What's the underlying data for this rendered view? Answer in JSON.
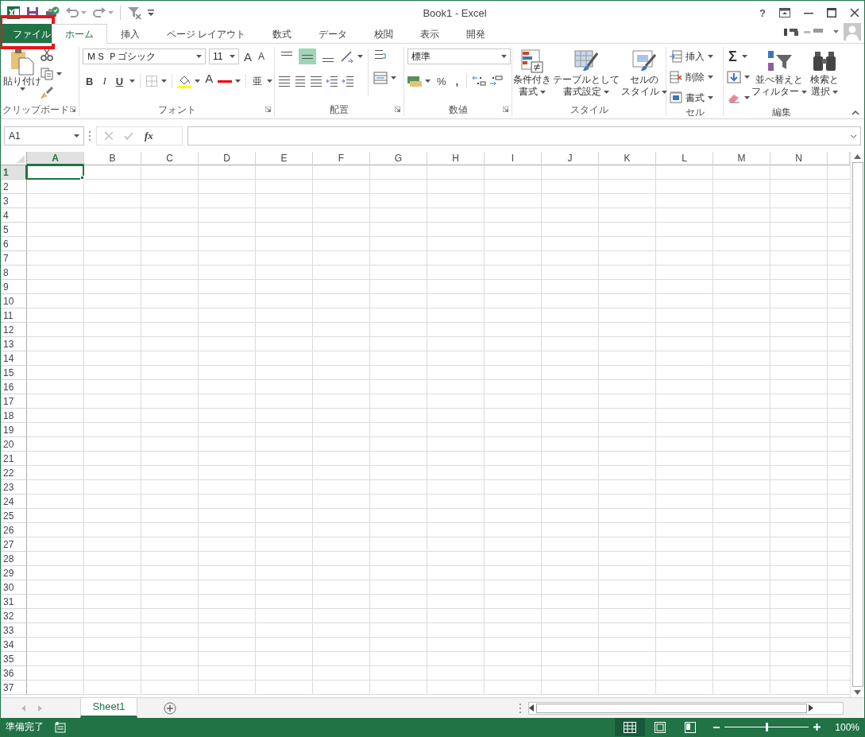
{
  "window": {
    "title": "Book1 - Excel",
    "help": "?"
  },
  "tabs": [
    {
      "label": "ファイル",
      "kind": "file",
      "selected": false,
      "highlighted": true
    },
    {
      "label": "ホーム",
      "kind": "tab",
      "selected": true,
      "highlighted": false
    },
    {
      "label": "挿入",
      "kind": "tab",
      "selected": false,
      "highlighted": false
    },
    {
      "label": "ページ レイアウト",
      "kind": "tab",
      "selected": false,
      "highlighted": false
    },
    {
      "label": "数式",
      "kind": "tab",
      "selected": false,
      "highlighted": false
    },
    {
      "label": "データ",
      "kind": "tab",
      "selected": false,
      "highlighted": false
    },
    {
      "label": "校閲",
      "kind": "tab",
      "selected": false,
      "highlighted": false
    },
    {
      "label": "表示",
      "kind": "tab",
      "selected": false,
      "highlighted": false
    },
    {
      "label": "開発",
      "kind": "tab",
      "selected": false,
      "highlighted": false
    }
  ],
  "ribbon": {
    "groups": [
      {
        "kind": "clipboard",
        "label": "クリップボード",
        "paste": "貼り付け"
      },
      {
        "kind": "font",
        "label": "フォント",
        "font_name": "ＭＳ Ｐゴシック",
        "font_size": "11",
        "grow": "A",
        "shrink": "A",
        "bold": "B",
        "italic": "I",
        "underline": "U",
        "font_color": "A",
        "phonetic": "亜"
      },
      {
        "kind": "alignment",
        "label": "配置",
        "vertical": [
          {
            "selected": false
          },
          {
            "selected": true
          },
          {
            "selected": false
          }
        ]
      },
      {
        "kind": "number",
        "label": "数値",
        "format": "標準",
        "percent": "%",
        "comma": ","
      },
      {
        "kind": "styles",
        "label": "スタイル",
        "buttons": [
          {
            "lines": [
              "条件付き",
              "書式"
            ]
          },
          {
            "lines": [
              "テーブルとして",
              "書式設定"
            ]
          },
          {
            "lines": [
              "セルの",
              "スタイル"
            ]
          }
        ]
      },
      {
        "kind": "cells",
        "label": "セル",
        "buttons": [
          "挿入",
          "削除",
          "書式"
        ]
      },
      {
        "kind": "editing",
        "label": "編集",
        "sum": "Σ",
        "buttons": [
          {
            "lines": [
              "並べ替えと",
              "フィルター"
            ]
          },
          {
            "lines": [
              "検索と",
              "選択"
            ]
          }
        ]
      }
    ]
  },
  "name_box": {
    "value": "A1"
  },
  "formula_bar": {
    "function_label": "fx"
  },
  "columns": [
    {
      "label": "A",
      "selected": true
    },
    {
      "label": "B",
      "selected": false
    },
    {
      "label": "C",
      "selected": false
    },
    {
      "label": "D",
      "selected": false
    },
    {
      "label": "E",
      "selected": false
    },
    {
      "label": "F",
      "selected": false
    },
    {
      "label": "G",
      "selected": false
    },
    {
      "label": "H",
      "selected": false
    },
    {
      "label": "I",
      "selected": false
    },
    {
      "label": "J",
      "selected": false
    },
    {
      "label": "K",
      "selected": false
    },
    {
      "label": "L",
      "selected": false
    },
    {
      "label": "M",
      "selected": false
    },
    {
      "label": "N",
      "selected": false
    }
  ],
  "rows": [
    {
      "label": "1",
      "selected": true
    },
    {
      "label": "2",
      "selected": false
    },
    {
      "label": "3",
      "selected": false
    },
    {
      "label": "4",
      "selected": false
    },
    {
      "label": "5",
      "selected": false
    },
    {
      "label": "6",
      "selected": false
    },
    {
      "label": "7",
      "selected": false
    },
    {
      "label": "8",
      "selected": false
    },
    {
      "label": "9",
      "selected": false
    },
    {
      "label": "10",
      "selected": false
    },
    {
      "label": "11",
      "selected": false
    },
    {
      "label": "12",
      "selected": false
    },
    {
      "label": "13",
      "selected": false
    },
    {
      "label": "14",
      "selected": false
    },
    {
      "label": "15",
      "selected": false
    },
    {
      "label": "16",
      "selected": false
    },
    {
      "label": "17",
      "selected": false
    },
    {
      "label": "18",
      "selected": false
    },
    {
      "label": "19",
      "selected": false
    },
    {
      "label": "20",
      "selected": false
    },
    {
      "label": "21",
      "selected": false
    },
    {
      "label": "22",
      "selected": false
    },
    {
      "label": "23",
      "selected": false
    },
    {
      "label": "24",
      "selected": false
    },
    {
      "label": "25",
      "selected": false
    },
    {
      "label": "26",
      "selected": false
    },
    {
      "label": "27",
      "selected": false
    },
    {
      "label": "28",
      "selected": false
    },
    {
      "label": "29",
      "selected": false
    },
    {
      "label": "30",
      "selected": false
    },
    {
      "label": "31",
      "selected": false
    },
    {
      "label": "32",
      "selected": false
    },
    {
      "label": "33",
      "selected": false
    },
    {
      "label": "34",
      "selected": false
    },
    {
      "label": "35",
      "selected": false
    },
    {
      "label": "36",
      "selected": false
    },
    {
      "label": "37",
      "selected": false
    }
  ],
  "sheet_tabs": [
    {
      "label": "Sheet1",
      "selected": true
    }
  ],
  "status_bar": {
    "status": "準備完了",
    "views": [
      {
        "selected": true
      },
      {
        "selected": false
      },
      {
        "selected": false
      }
    ],
    "zoom": {
      "level": 0.5
    },
    "zoom_label": "100%"
  }
}
